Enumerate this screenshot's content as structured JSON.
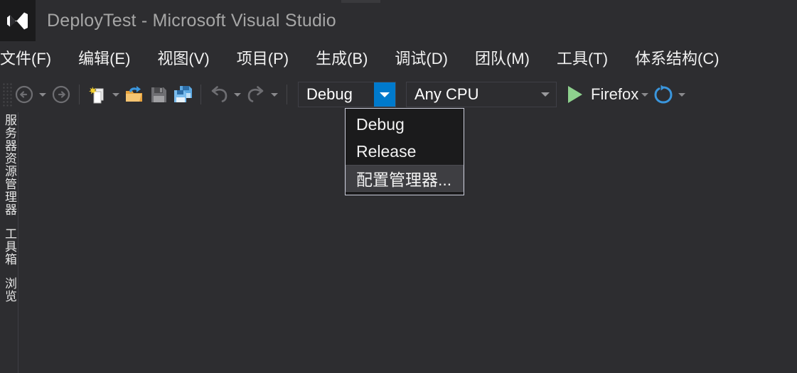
{
  "window": {
    "title": "DeployTest - Microsoft Visual Studio",
    "logo_icon": "visual-studio-logo-icon"
  },
  "menubar": {
    "items": [
      {
        "label": "文件(F)"
      },
      {
        "label": "编辑(E)"
      },
      {
        "label": "视图(V)"
      },
      {
        "label": "项目(P)"
      },
      {
        "label": "生成(B)"
      },
      {
        "label": "调试(D)"
      },
      {
        "label": "团队(M)"
      },
      {
        "label": "工具(T)"
      },
      {
        "label": "体系结构(C)"
      }
    ]
  },
  "toolbar": {
    "grip_icon": "drag-grip-icon",
    "nav_back_icon": "navigate-back-icon",
    "nav_back_dropdown_icon": "chevron-down-icon",
    "nav_forward_icon": "navigate-forward-icon",
    "new_item_icon": "new-item-icon",
    "new_item_dropdown_icon": "chevron-down-icon",
    "open_file_icon": "open-folder-icon",
    "save_icon": "save-icon",
    "save_all_icon": "save-all-icon",
    "undo_icon": "undo-icon",
    "undo_dropdown_icon": "chevron-down-icon",
    "redo_icon": "redo-icon",
    "redo_dropdown_icon": "chevron-down-icon",
    "configuration": {
      "value": "Debug",
      "dropdown_icon": "chevron-down-icon",
      "accent_color": "#007acc"
    },
    "platform": {
      "value": "Any CPU",
      "dropdown_icon": "chevron-down-icon"
    },
    "run": {
      "play_icon": "play-triangle-icon",
      "label": "Firefox",
      "dropdown_icon": "chevron-down-icon",
      "accent_color": "#8ed18e"
    },
    "refresh": {
      "icon": "refresh-circular-arrow-icon",
      "dropdown_icon": "chevron-down-icon",
      "accent_color": "#3a96dd"
    }
  },
  "sidebar": {
    "tabs": [
      {
        "label": "服务器资源管理器"
      },
      {
        "label": "工具箱"
      },
      {
        "label": "浏览"
      }
    ]
  },
  "configuration_dropdown": {
    "items": [
      {
        "label": "Debug",
        "selected": false
      },
      {
        "label": "Release",
        "selected": false
      },
      {
        "label": "配置管理器...",
        "selected": true
      }
    ],
    "highlight_color": "#3e3e42",
    "border_color": "#cccedb"
  },
  "theme": {
    "background": "#2d2d30",
    "menu_background": "#1b1b1c",
    "text_color": "#f1f1f1",
    "title_text_color": "#a6a6a6"
  }
}
